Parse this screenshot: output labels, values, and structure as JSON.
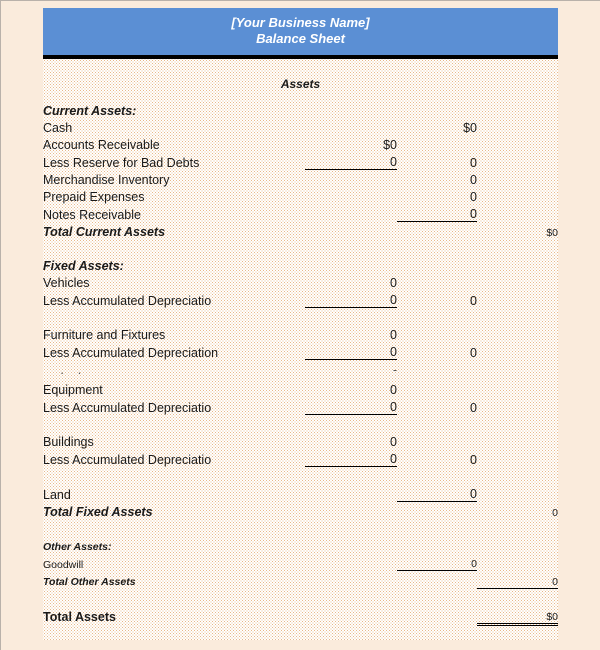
{
  "document": {
    "business_name": "[Your Business Name]",
    "doc_title": "Balance Sheet",
    "section_heading": "Assets"
  },
  "colors": {
    "banner_background": "#5b8fd4",
    "banner_text": "#ffffff",
    "page_background": "#faebdc",
    "rule": "#000000",
    "dot_texture": "#e8b98a"
  },
  "sections": {
    "current_assets": {
      "heading": "Current Assets:",
      "rows": [
        {
          "label": "Cash",
          "col1": "",
          "col2": "$0",
          "col3": ""
        },
        {
          "label": "Accounts Receivable",
          "col1": "$0",
          "col2": "",
          "col3": ""
        },
        {
          "label": "Less Reserve for Bad Debts",
          "col1": "0",
          "col2": "0",
          "col3": ""
        },
        {
          "label": "Merchandise Inventory",
          "col1": "",
          "col2": "0",
          "col3": ""
        },
        {
          "label": "Prepaid Expenses",
          "col1": "",
          "col2": "0",
          "col3": ""
        },
        {
          "label": "Notes Receivable",
          "col1": "",
          "col2": "0",
          "col3": ""
        }
      ],
      "total_label": "Total Current Assets",
      "total_value": "$0"
    },
    "fixed_assets": {
      "heading": "Fixed Assets:",
      "rows": [
        {
          "label": "Vehicles",
          "col1": "0",
          "col2": "",
          "col3": ""
        },
        {
          "label": "Less Accumulated Depreciatio",
          "col1": "0",
          "col2": "0",
          "col3": ""
        },
        {
          "label": "Furniture and Fixtures",
          "col1": "0",
          "col2": "",
          "col3": ""
        },
        {
          "label": "Less Accumulated Depreciation",
          "col1": "0",
          "col2": "0",
          "col3": ""
        },
        {
          "label": "Equipment",
          "col1": "0",
          "col2": "",
          "col3": ""
        },
        {
          "label": "Less Accumulated Depreciatio",
          "col1": "0",
          "col2": "0",
          "col3": ""
        },
        {
          "label": "Buildings",
          "col1": "0",
          "col2": "",
          "col3": ""
        },
        {
          "label": "Less Accumulated Depreciatio",
          "col1": "0",
          "col2": "0",
          "col3": ""
        },
        {
          "label": "Land",
          "col1": "",
          "col2": "0",
          "col3": ""
        }
      ],
      "total_label": "Total Fixed Assets",
      "total_value": "0"
    },
    "other_assets": {
      "heading": "Other Assets:",
      "rows": [
        {
          "label": "Goodwill",
          "col1": "",
          "col2": "0",
          "col3": ""
        }
      ],
      "total_label": "Total Other Assets",
      "total_value": "0"
    },
    "grand_total": {
      "label": "Total Assets",
      "value": "$0"
    }
  }
}
